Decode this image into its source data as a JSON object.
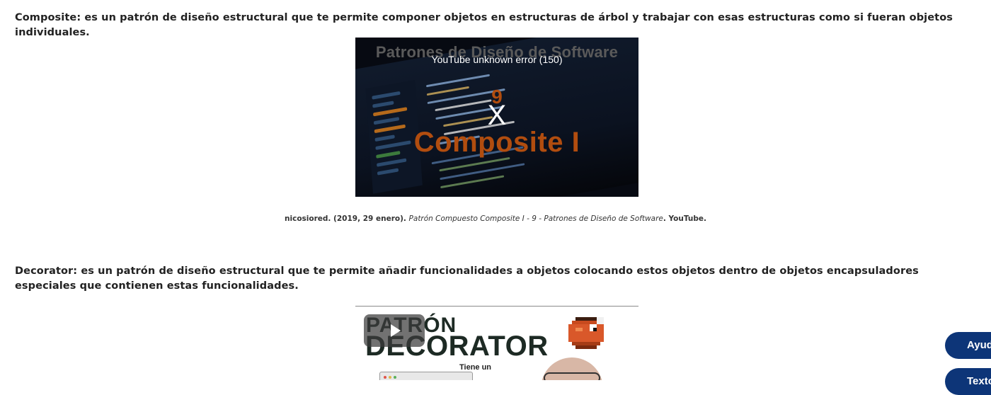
{
  "content": {
    "composite_paragraph": "Composite: es un patrón de diseño estructural que te permite componer objetos en estructuras de árbol y trabajar con esas estructuras como si fueran objetos individuales.",
    "decorator_paragraph": "Decorator: es un patrón de diseño estructural que te permite añadir funcionalidades a objetos colocando estos objetos dentro de objetos encapsuladores especiales que contienen estas funcionalidades."
  },
  "video1": {
    "banner_text": "Patrones de Diseño de Software",
    "error_text": "YouTube unknown error (150)",
    "episode_number": "9",
    "close_glyph": "X",
    "title_text": "Composite I"
  },
  "caption": {
    "prefix": "nicosiored. (2019, 29 enero). ",
    "title": "Patrón Compuesto Composite I - 9 - Patrones de Diseño de Software",
    "suffix": ". YouTube."
  },
  "video2": {
    "title_line1": "PATRÓN",
    "title_line2": "DECORATOR",
    "note_text": "Tiene un",
    "play_icon": "play-icon"
  },
  "floating_buttons": {
    "help_label": "Ayuda",
    "text_label": "Texto"
  },
  "colors": {
    "accent_orange": "#b14d0f",
    "button_navy": "#0d3578"
  }
}
